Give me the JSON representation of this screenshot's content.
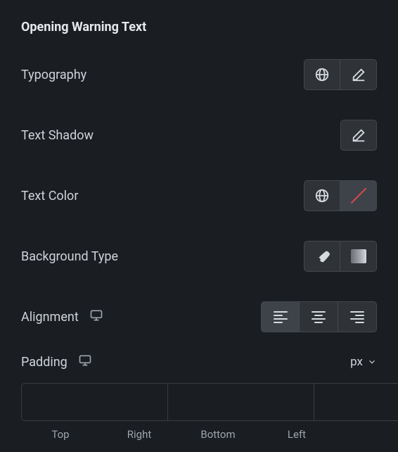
{
  "section": {
    "title": "Opening Warning Text"
  },
  "rows": {
    "typography": {
      "label": "Typography"
    },
    "textShadow": {
      "label": "Text Shadow"
    },
    "textColor": {
      "label": "Text Color"
    },
    "backgroundType": {
      "label": "Background Type"
    },
    "alignment": {
      "label": "Alignment",
      "value": "left"
    },
    "padding": {
      "label": "Padding",
      "unit": "px",
      "linked": true,
      "values": {
        "top": "",
        "right": "",
        "bottom": "",
        "left": ""
      },
      "sideLabels": {
        "top": "Top",
        "right": "Right",
        "bottom": "Bottom",
        "left": "Left"
      }
    }
  }
}
